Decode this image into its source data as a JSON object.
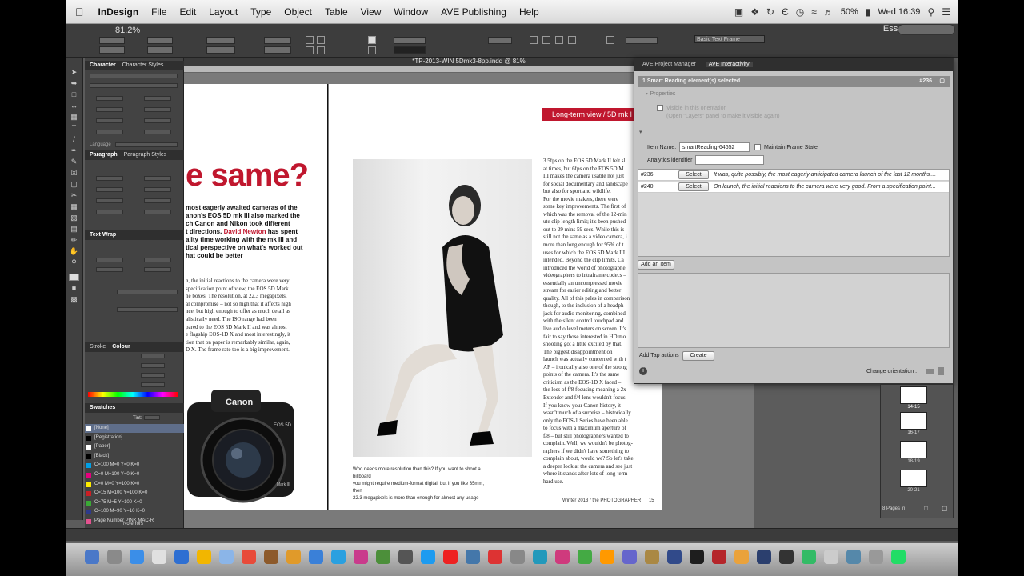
{
  "menubar": {
    "apple": "",
    "app": "InDesign",
    "items": [
      "File",
      "Edit",
      "Layout",
      "Type",
      "Object",
      "Table",
      "View",
      "Window",
      "AVE Publishing",
      "Help"
    ],
    "battery": "50%",
    "clock": "Wed 16:39"
  },
  "control_bar": {
    "zoom": "81.2%",
    "workspace": "Essentials",
    "frame_style": "Basic Text Frame"
  },
  "document": {
    "title": "*TP-2013-WIN 5Dmk3-8pp.indd @ 81%",
    "left_page": {
      "headline": "e same?",
      "intro_parts": [
        "most eagerly awaited cameras of the",
        "anon's EOS 5D mk III also marked the",
        "ch Canon and Nikon took different",
        "t directions.",
        "David Newton",
        "has spent",
        "ality time working with the mk III and",
        "tical perspective on what's worked out",
        "hat could be better"
      ],
      "body": [
        "n, the initial reactions to the camera were very",
        "specification point of view, the EOS 5D Mark",
        "he boxes. The resolution, at 22.3 megapixels,",
        "al compromise – not so high that it affects high",
        "nce, but high enough to offer as much detail as",
        "alistically need. The ISO range had been",
        "pared to the EOS 5D Mark II and was almost",
        "e flagship EOS-1D X and most interestingly, it",
        "tion that on paper is remarkably similar, again,",
        "D X. The frame rate too is a big improvement."
      ],
      "camera_brand": "Canon",
      "camera_model": "EOS 5D",
      "camera_mark": "Mark III"
    },
    "right_page": {
      "banner": "Long-term view / 5D mk I",
      "caption": [
        "Who needs more resolution than this? If you want to shoot a billboard",
        "you might require medium-format digital, but if you like 35mm, then",
        "22.3 megapixels is more than enough for almost any usage"
      ],
      "body": [
        "3.5fps on the EOS 5D Mark II felt sl",
        "at times, but 6fps on the EOS 5D M",
        "III makes the camera usable not just",
        "for social documentary and landscape",
        "but also for sport and wildlife.",
        "For the movie makers, there were",
        "some key improvements. The first of",
        "which was the removal of the 12-min",
        "ute clip length limit; it's been pushed",
        "out to 29 mins 59 secs. While this is",
        "still not the same as a video camera, i",
        "more than long enough for 95% of t",
        "uses for which the EOS 5D Mark III",
        "intended. Beyond the clip limits, Ca",
        "introduced the world of photographe",
        "videographers to intraframe codecs –",
        "essentially an uncompressed movie",
        "stream for easier editing and better",
        "quality. All of this pales in comparison",
        "though, to the inclusion of a headph",
        "jack for audio monitoring, combined",
        "with the silent control touchpad and",
        "live audio level meters on screen. It's",
        "fair to say those interested in HD mo",
        "shooting got a little excited by that.",
        "The biggest disappointment on",
        "launch was actually concerned with t",
        "AF – ironically also one of the strong",
        "points of the camera. It's the same",
        "criticism as the EOS-1D X faced –",
        "the loss of f/8 focusing meaning a 2x",
        "Extender and f/4 lens wouldn't focus.",
        "If you know your Canon history, it",
        "wasn't much of a surprise – historically",
        "only the EOS-1 Series have been able",
        "to focus with a maximum aperture of",
        "f/8 – but still photographers wanted to",
        "complain. Well, we wouldn't be photog-",
        "raphers if we didn't have something to",
        "complain about, would we? So let's take",
        "a deeper look at the camera and see just",
        "where it stands after lots of long-term",
        "hard use."
      ],
      "footer": "Winter 2013 / the PHOTOGRAPHER",
      "page_number": "15"
    }
  },
  "panels": {
    "character_tab": "Character",
    "character_styles_tab": "Character Styles",
    "language_label": "Language",
    "paragraph_tab": "Paragraph",
    "paragraph_styles_tab": "Paragraph Styles",
    "text_wrap_tab": "Text Wrap",
    "stroke_tab": "Stroke",
    "colour_tab": "Colour",
    "swatches_tab": "Swatches",
    "tint_label": "Tint:",
    "swatches": [
      {
        "name": "[None]",
        "color": "#ffffff"
      },
      {
        "name": "[Registration]",
        "color": "#000000"
      },
      {
        "name": "[Paper]",
        "color": "#ffffff"
      },
      {
        "name": "[Black]",
        "color": "#000000"
      },
      {
        "name": "C=100 M=0 Y=0 K=0",
        "color": "#00a0e6"
      },
      {
        "name": "C=0 M=100 Y=0 K=0",
        "color": "#e6007e"
      },
      {
        "name": "C=0 M=0 Y=100 K=0",
        "color": "#ffec00"
      },
      {
        "name": "C=15 M=100 Y=100 K=0",
        "color": "#cc1e24"
      },
      {
        "name": "C=75 M=5 Y=100 K=0",
        "color": "#3aa935"
      },
      {
        "name": "C=100 M=90 Y=10 K=0",
        "color": "#2d3a8c"
      },
      {
        "name": "Page Number PINK MAC-R",
        "color": "#e3528f"
      }
    ],
    "no_errors": "No errors"
  },
  "ave": {
    "tabs": [
      "AVE Project Manager",
      "AVE Interactivity"
    ],
    "selection": "1 Smart Reading element(s)  selected",
    "selection_id": "#236",
    "properties": "Properties",
    "visible_line1": "Visible in this orientation",
    "visible_line2": "(Open \"Layers\" panel to make it visible again)",
    "item_name_label": "Item Name:",
    "item_name_value": "smartReading-64652",
    "maintain_frame_state": "Maintain Frame State",
    "analytics_label": "Analytics identifier",
    "items": [
      {
        "id": "#236",
        "select": "Select",
        "text": "It was, quite possibly, the most eagerly anticipated camera launch of the last 12 months...."
      },
      {
        "id": "#240",
        "select": "Select",
        "text": "On launch, the initial reactions to the camera were very good. From a specification point..."
      }
    ],
    "add_item": "Add an Item",
    "add_tap_actions": "Add Tap actions",
    "create": "Create",
    "change_orientation": "Change orientation :"
  },
  "pages_panel": {
    "pages": [
      "14-15",
      "16-17",
      "18-19",
      "20-21"
    ],
    "count": "8 Pages in"
  },
  "colors": {
    "accent_red": "#c0172e",
    "panel_dark": "#434343",
    "ave_panel": "#c4c4c4"
  }
}
